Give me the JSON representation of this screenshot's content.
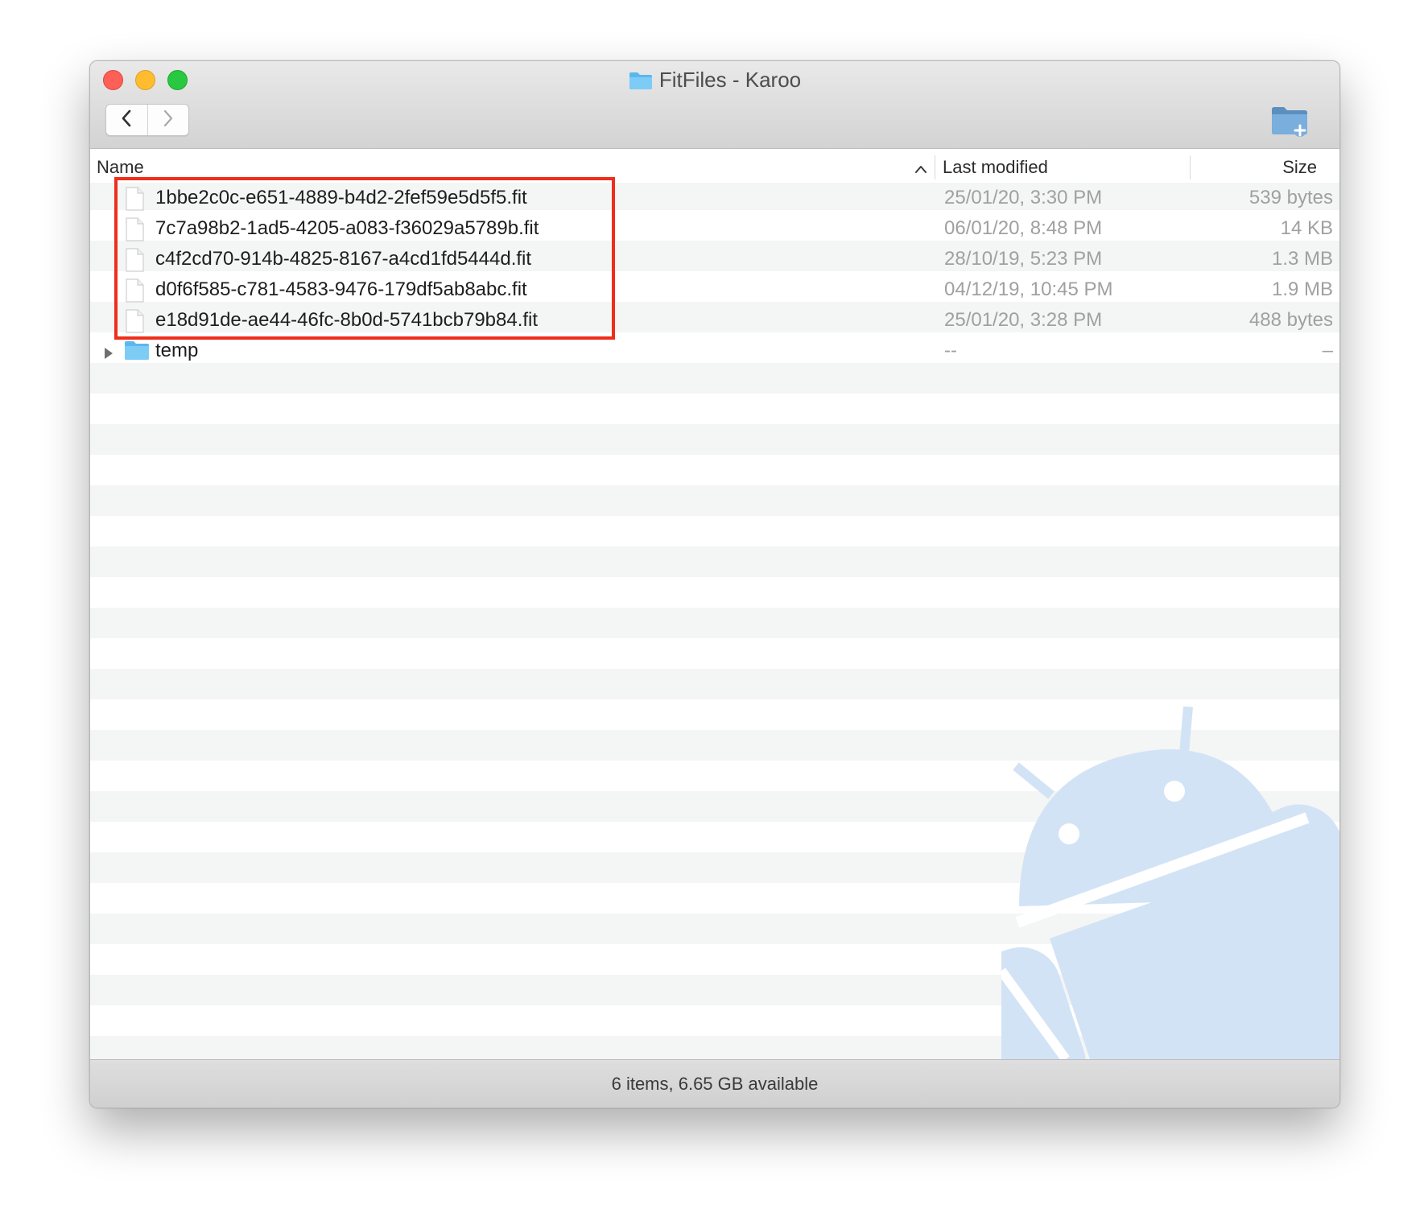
{
  "window": {
    "title": "FitFiles - Karoo",
    "folder_icon": "folder-icon",
    "controls": [
      "close",
      "minimize",
      "zoom"
    ],
    "nav": {
      "back_icon": "chevron-left-icon",
      "forward_icon": "chevron-right-icon"
    },
    "toolbar": {
      "new_folder_icon": "new-folder-icon"
    }
  },
  "columns": {
    "name": "Name",
    "last_modified": "Last modified",
    "size": "Size",
    "sort_indicator": "chevron-up-icon"
  },
  "files": [
    {
      "name": "1bbe2c0c-e651-4889-b4d2-2fef59e5d5f5.fit",
      "modified": "25/01/20, 3:30 PM",
      "size": "539 bytes",
      "kind": "file"
    },
    {
      "name": "7c7a98b2-1ad5-4205-a083-f36029a5789b.fit",
      "modified": "06/01/20, 8:48 PM",
      "size": "14 KB",
      "kind": "file"
    },
    {
      "name": "c4f2cd70-914b-4825-8167-a4cd1fd5444d.fit",
      "modified": "28/10/19, 5:23 PM",
      "size": "1.3 MB",
      "kind": "file"
    },
    {
      "name": "d0f6f585-c781-4583-9476-179df5ab8abc.fit",
      "modified": "04/12/19, 10:45 PM",
      "size": "1.9 MB",
      "kind": "file"
    },
    {
      "name": "e18d91de-ae44-46fc-8b0d-5741bcb79b84.fit",
      "modified": "25/01/20, 3:28 PM",
      "size": "488 bytes",
      "kind": "file"
    },
    {
      "name": "temp",
      "modified": "--",
      "size": "–",
      "kind": "folder"
    }
  ],
  "status": {
    "text": "6 items, 6.65 GB available"
  },
  "colors": {
    "highlight": "#ef2d19",
    "folder": "#6cc1f3",
    "watermark": "#d3e3f6"
  }
}
